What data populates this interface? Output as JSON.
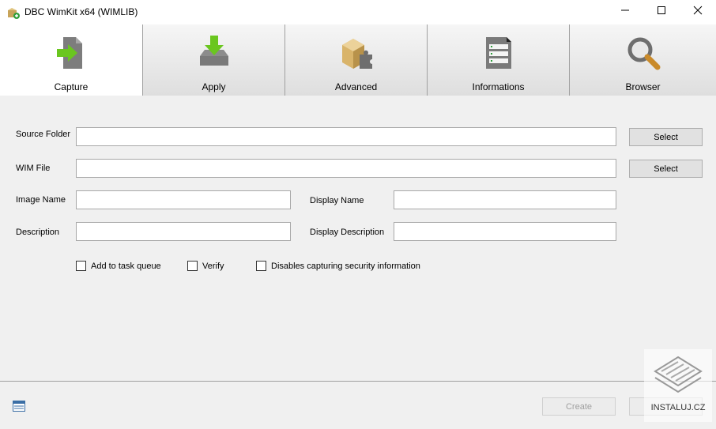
{
  "window": {
    "title": "DBC WimKit x64 (WIMLIB)",
    "minimize_icon": "minimize-icon",
    "maximize_icon": "maximize-icon",
    "close_icon": "close-icon"
  },
  "tabs": [
    {
      "label": "Capture",
      "icon": "capture-icon",
      "active": true
    },
    {
      "label": "Apply",
      "icon": "apply-icon",
      "active": false
    },
    {
      "label": "Advanced",
      "icon": "advanced-icon",
      "active": false
    },
    {
      "label": "Informations",
      "icon": "informations-icon",
      "active": false
    },
    {
      "label": "Browser",
      "icon": "browser-icon",
      "active": false
    }
  ],
  "form": {
    "source_folder_label": "Source Folder",
    "source_folder_value": "",
    "wim_file_label": "WIM File",
    "wim_file_value": "",
    "image_name_label": "Image Name",
    "image_name_value": "",
    "display_name_label": "Display Name",
    "display_name_value": "",
    "description_label": "Description",
    "description_value": "",
    "display_description_label": "Display Description",
    "display_description_value": "",
    "select_source_label": "Select",
    "select_wim_label": "Select"
  },
  "options": [
    {
      "label": "Add to task queue",
      "checked": false
    },
    {
      "label": "Verify",
      "checked": false
    },
    {
      "label": "Disables capturing security information",
      "checked": false
    }
  ],
  "footer": {
    "create_label": "Create",
    "list_icon": "list-view-icon"
  },
  "watermark": {
    "text": "INSTALUJ.CZ"
  },
  "colors": {
    "accent_green": "#6ac61f",
    "window_bg": "#f0f0f0"
  }
}
